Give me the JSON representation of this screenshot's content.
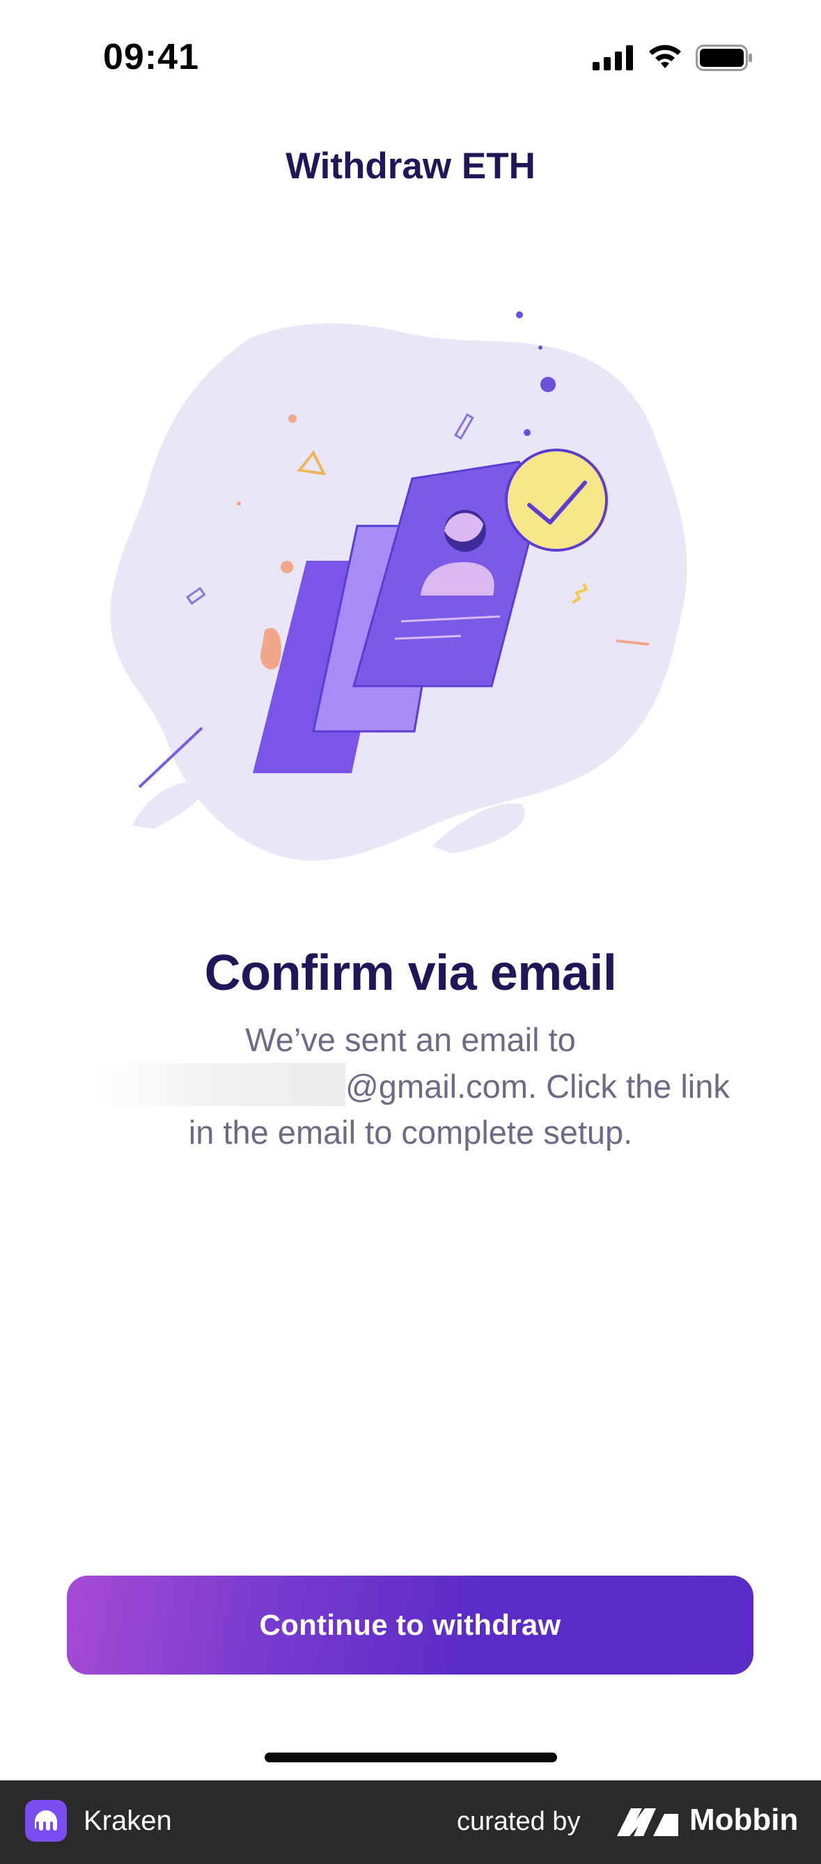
{
  "status_bar": {
    "time": "09:41",
    "icons": [
      "cellular-signal-icon",
      "wifi-icon",
      "battery-icon"
    ]
  },
  "header": {
    "title": "Withdraw ETH"
  },
  "illustration": {
    "icon": "identity-verification-illustration"
  },
  "content": {
    "title": "Confirm via email",
    "line1": "We’ve sent an email to",
    "line2_suffix": "@gmail.com. Click the link",
    "line3": "in the email to complete setup."
  },
  "cta": {
    "label": "Continue to withdraw"
  },
  "footer": {
    "app_name": "Kraken",
    "curated_by": "curated by",
    "brand": "Mobbin"
  },
  "colors": {
    "title": "#1f1758",
    "body": "#6e6a86",
    "accent": "#5a2bc6",
    "footer_bg": "#2a2a2a"
  }
}
